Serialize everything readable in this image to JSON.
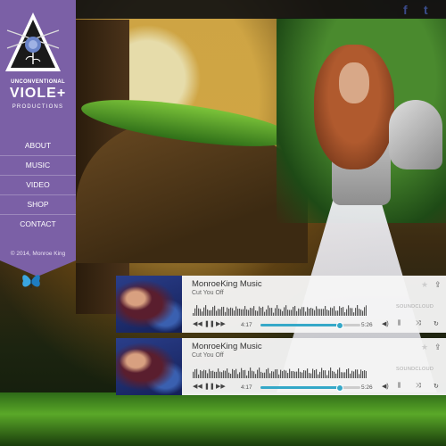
{
  "brand": {
    "line1": "UNCONVENTIONAL",
    "line2": "VIOLE+",
    "line3": "PRODUCTIONS"
  },
  "nav": {
    "items": [
      {
        "label": "ABOUT"
      },
      {
        "label": "MUSIC"
      },
      {
        "label": "VIDEO"
      },
      {
        "label": "SHOP"
      },
      {
        "label": "CONTACT"
      }
    ]
  },
  "copyright": "© 2014, Monroe King",
  "social": {
    "facebook_glyph": "f",
    "twitter_glyph": "t"
  },
  "players": [
    {
      "title": "MonroeKing Music",
      "subtitle": "Cut You Off",
      "elapsed": "4:17",
      "duration": "5:26",
      "progress": 0.79,
      "brand": "SOUNDCLOUD"
    },
    {
      "title": "MonroeKing Music",
      "subtitle": "Cut You Off",
      "elapsed": "4:17",
      "duration": "5:26",
      "progress": 0.79,
      "brand": "SOUNDCLOUD"
    }
  ],
  "colors": {
    "sidebar": "#7b60a6",
    "accent": "#35a8c8",
    "topbar": "#111111"
  },
  "icons": {
    "facebook": "facebook-icon",
    "twitter": "twitter-icon",
    "logo": "rose-triangle-logo",
    "butterfly": "butterfly-icon"
  }
}
